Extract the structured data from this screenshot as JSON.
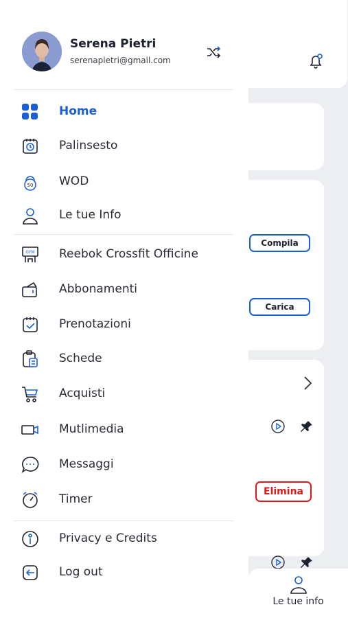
{
  "colors": {
    "accent": "#1a5fd6",
    "danger": "#e01818",
    "text": "#2a2d36",
    "background": "#eceef1"
  },
  "user": {
    "name": "Serena Pietri",
    "email": "serenapietri@gmail.com",
    "switch_icon": "shuffle-icon"
  },
  "menu": {
    "primary": [
      {
        "label": "Home",
        "icon": "grid-icon",
        "active": true
      },
      {
        "label": "Palinsesto",
        "icon": "calendar-clock-icon",
        "active": false
      },
      {
        "label": "WOD",
        "icon": "kettlebell-icon",
        "active": false
      },
      {
        "label": "Le tue Info",
        "icon": "user-icon",
        "active": false
      }
    ],
    "secondary": [
      {
        "label": "Reebok Crossfit Officine",
        "icon": "gym-icon"
      },
      {
        "label": "Abbonamenti",
        "icon": "membership-icon"
      },
      {
        "label": "Prenotazioni",
        "icon": "calendar-check-icon"
      },
      {
        "label": "Schede",
        "icon": "clipboard-icon"
      },
      {
        "label": "Acquisti",
        "icon": "cart-icon"
      },
      {
        "label": "Mutlimedia",
        "icon": "video-icon"
      },
      {
        "label": "Messaggi",
        "icon": "chat-icon"
      },
      {
        "label": "Timer",
        "icon": "timer-icon"
      }
    ],
    "tertiary": [
      {
        "label": "Privacy e Credits",
        "icon": "info-icon"
      },
      {
        "label": "Log out",
        "icon": "logout-icon"
      }
    ]
  },
  "background": {
    "compila_label": "Compila",
    "carica_label": "Carica",
    "elimina_label": "Elimina",
    "bottom_nav_label": "Le tue info"
  }
}
